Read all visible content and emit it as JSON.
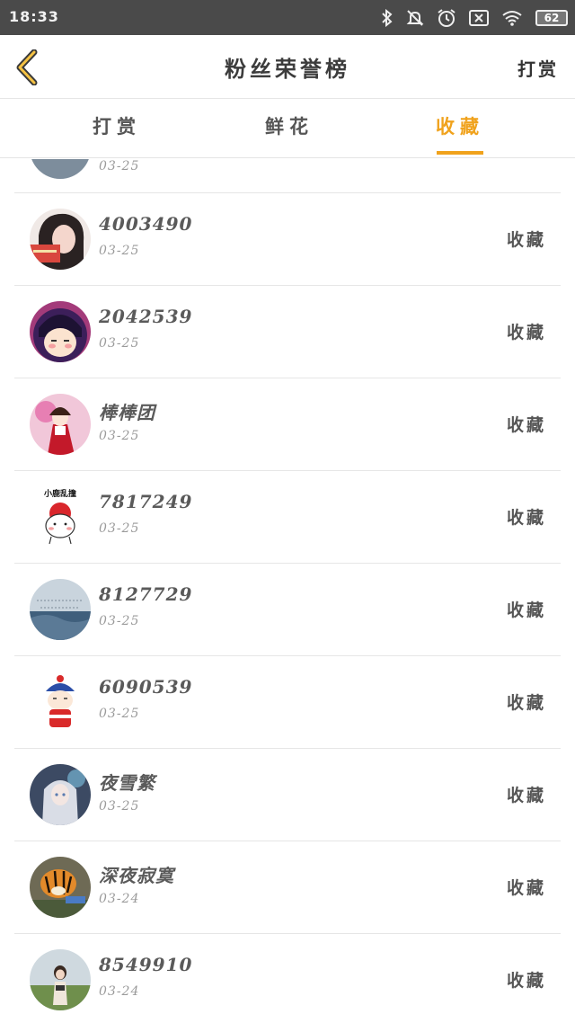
{
  "status_bar": {
    "time": "18:33",
    "battery": "62",
    "icons": [
      "bluetooth-icon",
      "bell-off-icon",
      "alarm-icon",
      "sim-x-icon",
      "wifi-icon",
      "battery-icon"
    ]
  },
  "header": {
    "title": "粉丝荣誉榜",
    "right_label": "打赏",
    "back_icon": "chevron-left-icon",
    "accent_color": "#f0a21c"
  },
  "tabs": [
    {
      "label": "打赏",
      "active": false
    },
    {
      "label": "鲜花",
      "active": false
    },
    {
      "label": "收藏",
      "active": true
    }
  ],
  "partial_row": {
    "date": "03-25"
  },
  "rows": [
    {
      "name": "4003490",
      "date": "03-25",
      "action": "收藏"
    },
    {
      "name": "2042539",
      "date": "03-25",
      "action": "收藏"
    },
    {
      "name": "棒棒团",
      "date": "03-25",
      "action": "收藏"
    },
    {
      "name": "7817249",
      "date": "03-25",
      "action": "收藏",
      "avatar_text": "小鹿乱撞"
    },
    {
      "name": "8127729",
      "date": "03-25",
      "action": "收藏"
    },
    {
      "name": "6090539",
      "date": "03-25",
      "action": "收藏"
    },
    {
      "name": "夜雪繁",
      "date": "03-25",
      "action": "收藏"
    },
    {
      "name": "深夜寂寞",
      "date": "03-24",
      "action": "收藏"
    },
    {
      "name": "8549910",
      "date": "03-24",
      "action": "收藏"
    }
  ]
}
